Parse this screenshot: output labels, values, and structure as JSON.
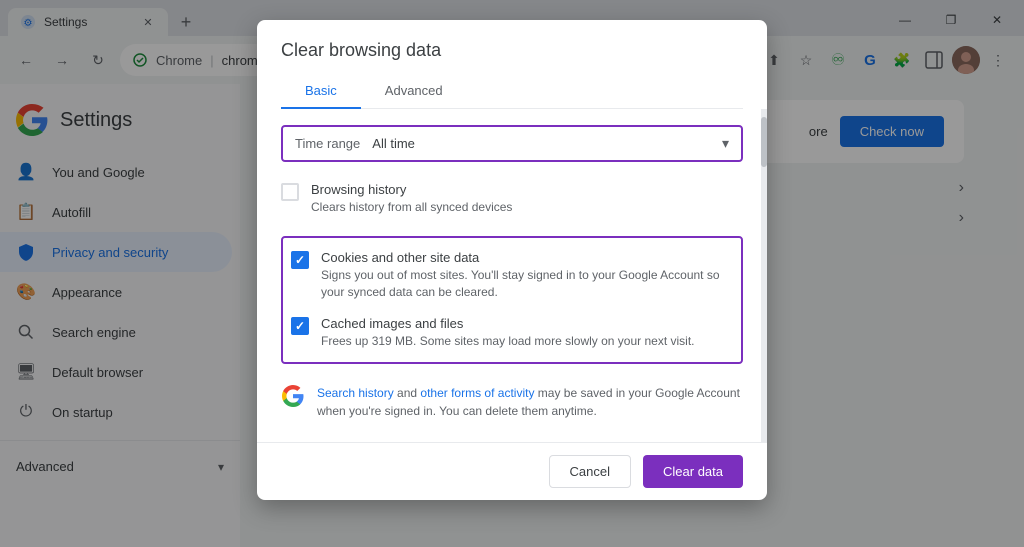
{
  "browser": {
    "tab_title": "Settings",
    "tab_icon": "⚙",
    "url_brand": "Chrome",
    "url_path": "chrome://settings/clearBrowserData",
    "new_tab_label": "+",
    "window_controls": {
      "minimize": "—",
      "maximize": "❐",
      "close": "✕"
    }
  },
  "toolbar": {
    "back": "←",
    "forward": "→",
    "refresh": "↻",
    "share_icon": "⬆",
    "bookmark_icon": "☆",
    "extension1": "♻",
    "extension2": "G",
    "puzzle_icon": "🧩",
    "sidebar_icon": "▭",
    "more_icon": "⋮"
  },
  "sidebar": {
    "app_title": "Settings",
    "items": [
      {
        "id": "you-and-google",
        "label": "You and Google",
        "icon": "👤"
      },
      {
        "id": "autofill",
        "label": "Autofill",
        "icon": "📝"
      },
      {
        "id": "privacy-security",
        "label": "Privacy and security",
        "icon": "🛡",
        "active": true
      },
      {
        "id": "appearance",
        "label": "Appearance",
        "icon": "🎨"
      },
      {
        "id": "search-engine",
        "label": "Search engine",
        "icon": "🔍"
      },
      {
        "id": "default-browser",
        "label": "Default browser",
        "icon": "🖥"
      },
      {
        "id": "on-startup",
        "label": "On startup",
        "icon": "⏻"
      }
    ],
    "advanced": "Advanced",
    "advanced_arrow": "▾"
  },
  "right_content": {
    "more_text": "ore",
    "check_now_label": "Check now",
    "arrow1": "›",
    "arrow2": "›"
  },
  "dialog": {
    "title": "Clear browsing data",
    "tabs": [
      {
        "id": "basic",
        "label": "Basic",
        "active": true
      },
      {
        "id": "advanced",
        "label": "Advanced",
        "active": false
      }
    ],
    "time_range": {
      "label": "Time range",
      "value": "All time",
      "arrow": "▾"
    },
    "checkboxes": [
      {
        "id": "browsing-history",
        "title": "Browsing history",
        "desc": "Clears history from all synced devices",
        "checked": false,
        "highlighted": false
      },
      {
        "id": "cookies",
        "title": "Cookies and other site data",
        "desc": "Signs you out of most sites. You'll stay signed in to your Google Account so your synced data can be cleared.",
        "checked": true,
        "highlighted": true
      },
      {
        "id": "cached",
        "title": "Cached images and files",
        "desc": "Frees up 319 MB. Some sites may load more slowly on your next visit.",
        "checked": true,
        "highlighted": true
      }
    ],
    "google_info": {
      "link1": "Search history",
      "text1": " and ",
      "link2": "other forms of activity",
      "text2": " may be saved in your Google Account when you're signed in. You can delete them anytime."
    },
    "footer": {
      "cancel_label": "Cancel",
      "clear_label": "Clear data"
    }
  }
}
